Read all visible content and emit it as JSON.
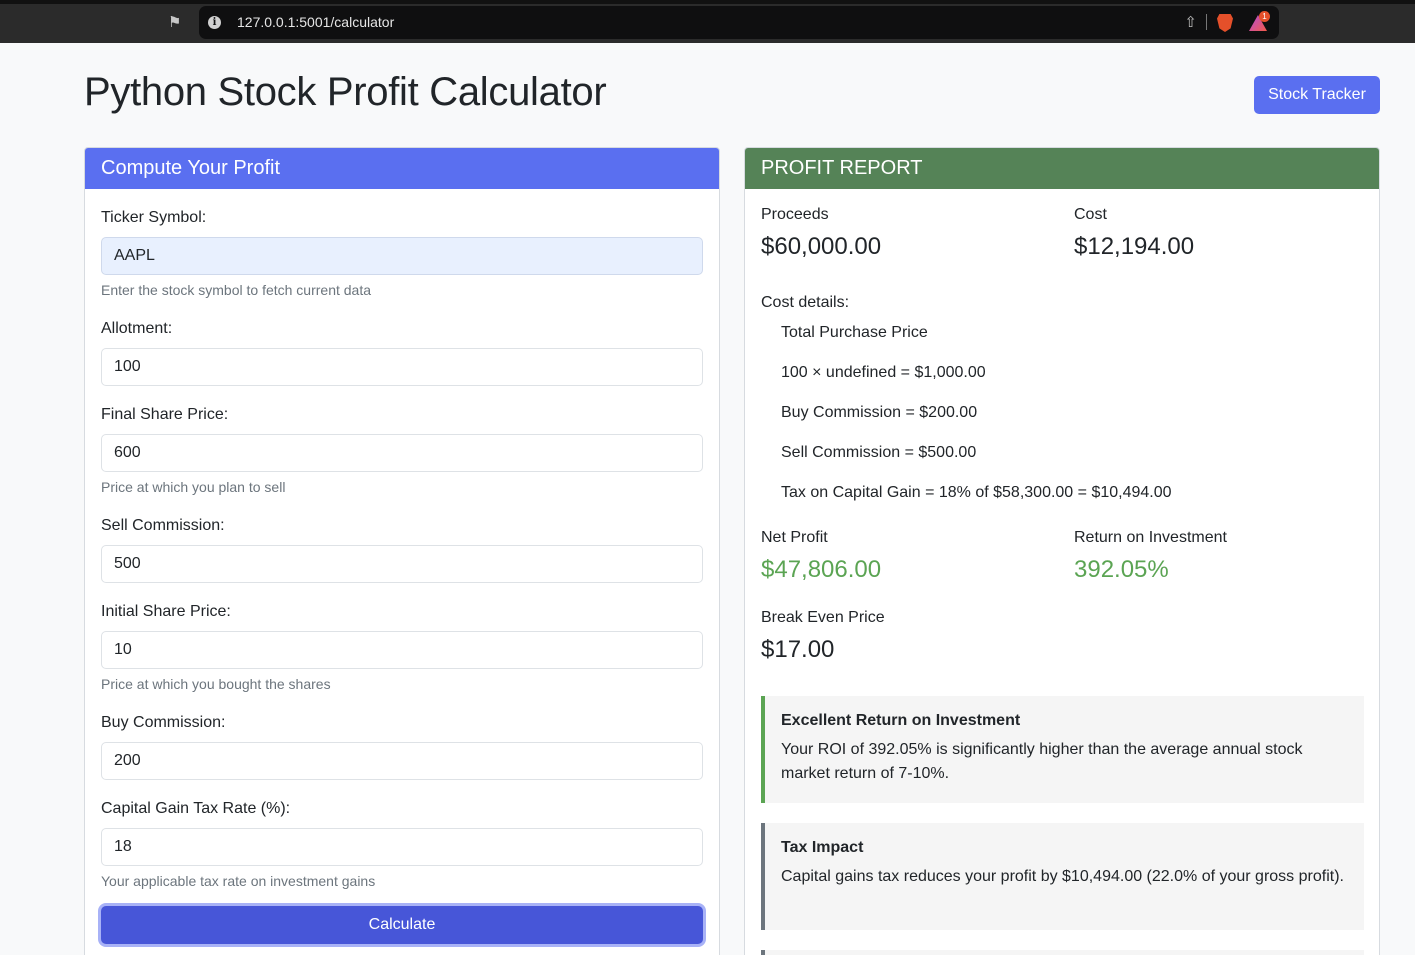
{
  "browser": {
    "url": "127.0.0.1:5001/calculator",
    "extension_badge": "1"
  },
  "header": {
    "title": "Python Stock Profit Calculator",
    "tracker_button": "Stock Tracker"
  },
  "form": {
    "card_title": "Compute Your Profit",
    "ticker": {
      "label": "Ticker Symbol:",
      "value": "AAPL",
      "help": "Enter the stock symbol to fetch current data"
    },
    "allotment": {
      "label": "Allotment:",
      "value": "100"
    },
    "final_price": {
      "label": "Final Share Price:",
      "value": "600",
      "help": "Price at which you plan to sell"
    },
    "sell_commission": {
      "label": "Sell Commission:",
      "value": "500"
    },
    "initial_price": {
      "label": "Initial Share Price:",
      "value": "10",
      "help": "Price at which you bought the shares"
    },
    "buy_commission": {
      "label": "Buy Commission:",
      "value": "200"
    },
    "tax_rate": {
      "label": "Capital Gain Tax Rate (%):",
      "value": "18",
      "help": "Your applicable tax rate on investment gains"
    },
    "calculate_button": "Calculate"
  },
  "report": {
    "card_title": "PROFIT REPORT",
    "proceeds_label": "Proceeds",
    "proceeds_value": "$60,000.00",
    "cost_label": "Cost",
    "cost_value": "$12,194.00",
    "cost_details_label": "Cost details:",
    "cost_details": [
      "Total Purchase Price",
      "100 × undefined = $1,000.00",
      "Buy Commission = $200.00",
      "Sell Commission = $500.00",
      "Tax on Capital Gain = 18% of $58,300.00 = $10,494.00"
    ],
    "net_profit_label": "Net Profit",
    "net_profit_value": "$47,806.00",
    "roi_label": "Return on Investment",
    "roi_value": "392.05%",
    "break_even_label": "Break Even Price",
    "break_even_value": "$17.00",
    "callouts": [
      {
        "title": "Excellent Return on Investment",
        "text": "Your ROI of 392.05% is significantly higher than the average annual stock market return of 7-10%."
      },
      {
        "title": "Tax Impact",
        "text": "Capital gains tax reduces your profit by $10,494.00 (22.0% of your gross profit)."
      }
    ]
  },
  "colors": {
    "primary": "#5a6ff0",
    "report_header": "#558357",
    "positive": "#5ba453"
  }
}
